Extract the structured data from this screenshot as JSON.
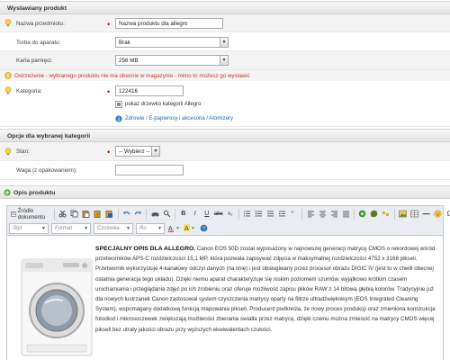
{
  "sections": {
    "product": "Wystawiany produkt",
    "category_options": "Opcje dla wybranej kategorii",
    "description": "Opis produktu"
  },
  "fields": {
    "name": {
      "label": "Nazwa przedmiotu:",
      "value": "Nazwa produktu dla allegro"
    },
    "bag": {
      "label": "Torba do aparatu:",
      "value": "Brak"
    },
    "card": {
      "label": "Karta pamięci:",
      "value": "256 MB"
    },
    "category": {
      "label": "Kategoria:",
      "value": "122416"
    },
    "state": {
      "label": "Stan:",
      "value": "-- Wybierz --"
    },
    "weight": {
      "label": "Waga (z opakowaniem):",
      "value": ""
    }
  },
  "warning": "Ostrzeżenie - wybranego produktu nie ma obecnie w magazynie - mimo to możesz go wystawić",
  "category_tree_link": "pokaż drzewko kategorii Allegro",
  "category_path": "Zdrowie / E-papierosy i akcesoria / Atomizery",
  "toolbar": {
    "source": "Źródło dokumentu",
    "style": "Styl",
    "format": "Format",
    "font": "Czcionka",
    "size": "Ro"
  },
  "description": {
    "heading": "SPECJALNY OPIS DLA ALLEGRO.",
    "text": "Canon EOS 50D został wyposażony w najnowszej generacji matrycę CMOS o rekordowej wśród przetworników APS-C rozdzielczości 15,1 MP, która pozwala zapisywać zdjęcia w maksymalnej rozdzielczości 4752 x 3168 pikseli. Przetwornik wykorzystuje 4-kanałowy odczyt danych (na linię) i jest obsługiwany przez procesor obrazu DIGIC IV (jest to w chwili obecnej ostatnia generacja tego układu). Dzięki niemu aparat charakteryzuje się niskim poziomem szumów, wyjątkowo krótkim czasem uruchamiania i przeglądania zdjęć po ich zrobieniu oraz oferuje możliwość zapisu plików RAW z 14 bitową głębią kolorów. Tradycyjnie już dla nowych lustrzanek Canon zastosował system czyszczenia matrycy oparty na filtrze ultradźwiękowym (EOS Integrated Cleaning System), wspomagany dodatkową funkcją mapowania pikseli. Producent podkreśla, że nowy proces produkcji oraz zmieniona konstrukcja fotodiod i mikrosoczewek zwiększają możliwości zbierania światła przez matrycę, dzięki czemu można zmieścić na matrycy CMOS więcej pikseli bez utraty jakości obrazu przy wyższych ekwiwalentach czułości."
  },
  "colors": {
    "required": "#d40000",
    "warning": "#c0392b",
    "link": "#2a64a8"
  }
}
